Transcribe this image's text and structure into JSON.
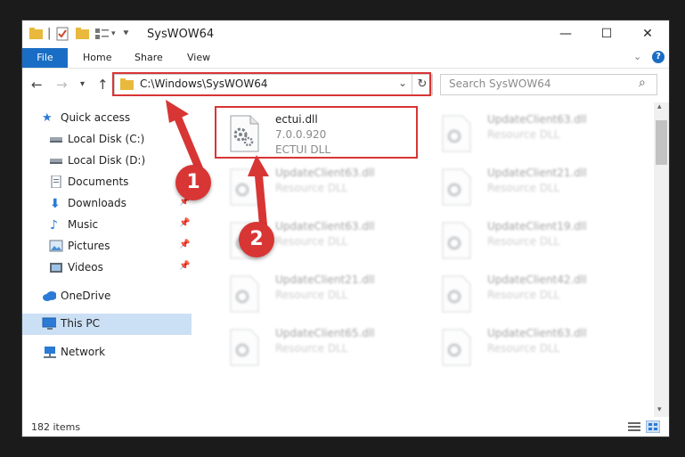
{
  "window": {
    "title": "SysWOW64",
    "minimize_label": "—",
    "maximize_label": "☐",
    "close_label": "✕"
  },
  "ribbon": {
    "tabs": [
      "File",
      "Home",
      "Share",
      "View"
    ]
  },
  "address_bar": {
    "path": "C:\\Windows\\SysWOW64",
    "search_placeholder": "Search SysWOW64"
  },
  "nav": {
    "items": [
      {
        "label": "Quick access",
        "icon": "star-icon",
        "pinned": false
      },
      {
        "label": "Local Disk (C:)",
        "icon": "drive-icon",
        "pinned": false
      },
      {
        "label": "Local Disk (D:)",
        "icon": "drive-icon",
        "pinned": false
      },
      {
        "label": "Documents",
        "icon": "documents-icon",
        "pinned": true
      },
      {
        "label": "Downloads",
        "icon": "download-icon",
        "pinned": true
      },
      {
        "label": "Music",
        "icon": "music-icon",
        "pinned": true
      },
      {
        "label": "Pictures",
        "icon": "pictures-icon",
        "pinned": true
      },
      {
        "label": "Videos",
        "icon": "videos-icon",
        "pinned": true
      },
      {
        "label": "OneDrive",
        "icon": "cloud-icon",
        "pinned": false
      },
      {
        "label": "This PC",
        "icon": "computer-icon",
        "pinned": false
      },
      {
        "label": "Network",
        "icon": "network-icon",
        "pinned": false
      }
    ],
    "pin_glyph": "📌"
  },
  "files": [
    {
      "name": "ectui.dll",
      "line2": "7.0.0.920",
      "line3": "ECTUI DLL"
    },
    {
      "name": "UpdateClient63.dll",
      "line2": "Resource DLL",
      "line3": ""
    },
    {
      "name": "UpdateClient63.dll",
      "line2": "Resource DLL",
      "line3": ""
    },
    {
      "name": "UpdateClient21.dll",
      "line2": "Resource DLL",
      "line3": ""
    },
    {
      "name": "UpdateClient63.dll",
      "line2": "Resource DLL",
      "line3": ""
    },
    {
      "name": "UpdateClient19.dll",
      "line2": "Resource DLL",
      "line3": ""
    },
    {
      "name": "UpdateClient21.dll",
      "line2": "Resource DLL",
      "line3": ""
    },
    {
      "name": "UpdateClient42.dll",
      "line2": "Resource DLL",
      "line3": ""
    },
    {
      "name": "UpdateClient65.dll",
      "line2": "Resource DLL",
      "line3": ""
    },
    {
      "name": "UpdateClient63.dll",
      "line2": "Resource DLL",
      "line3": ""
    }
  ],
  "status": {
    "item_count": "182 items"
  },
  "annotations": {
    "badge1": "1",
    "badge2": "2"
  },
  "colors": {
    "accent": "#1a6dc4",
    "annotation_red": "#d83535"
  }
}
